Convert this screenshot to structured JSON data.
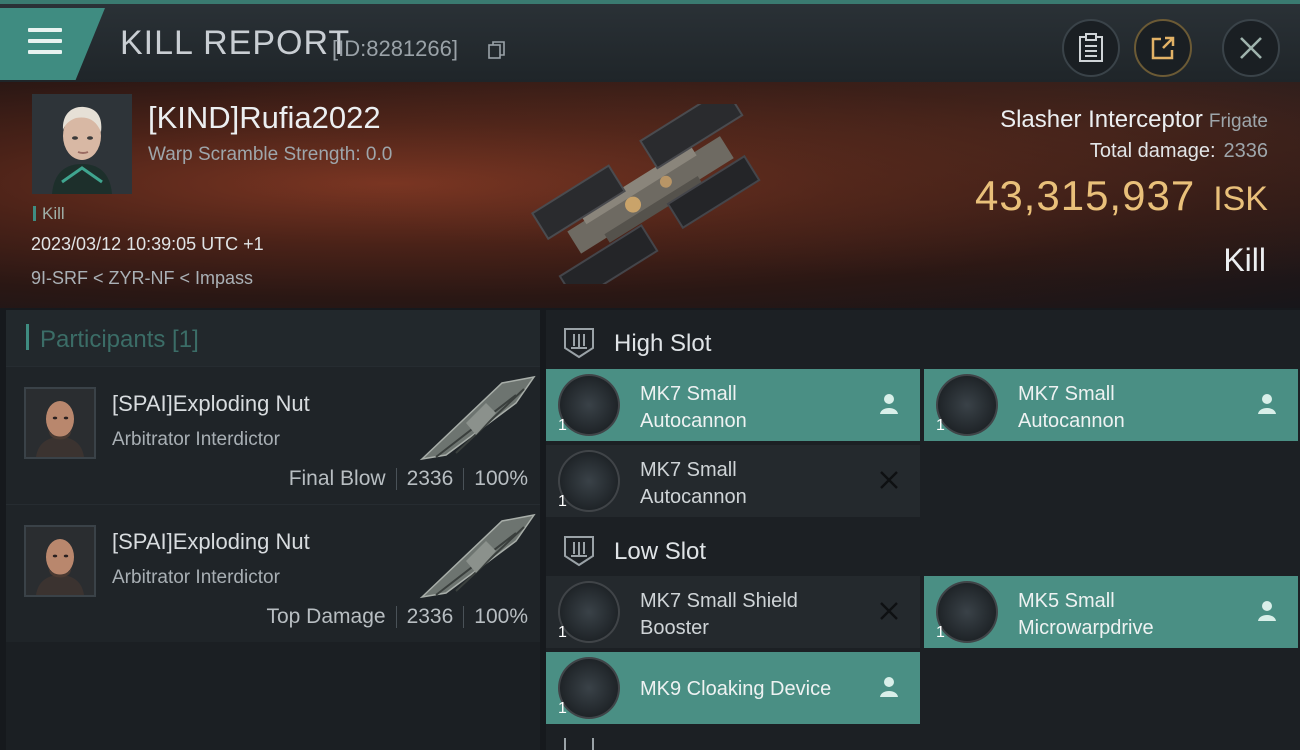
{
  "header": {
    "title": "KILL REPORT",
    "report_id": "[ID:8281266]"
  },
  "victim": {
    "name": "[KIND]Rufia2022",
    "scramble": "Warp Scramble Strength: 0.0",
    "tag": "Kill",
    "datetime": "2023/03/12 10:39:05 UTC +1",
    "location": "9I-SRF < ZYR-NF < Impass",
    "ship": "Slasher Interceptor",
    "ship_class": "Frigate",
    "total_damage_label": "Total damage:",
    "total_damage": "2336",
    "isk_value": "43,315,937",
    "isk_currency": "ISK",
    "result": "Kill"
  },
  "participants": {
    "label": "Participants [1]",
    "rows": [
      {
        "name": "[SPAI]Exploding Nut",
        "ship": "Arbitrator Interdictor",
        "role": "Final Blow",
        "damage": "2336",
        "percent": "100%"
      },
      {
        "name": "[SPAI]Exploding Nut",
        "ship": "Arbitrator Interdictor",
        "role": "Top Damage",
        "damage": "2336",
        "percent": "100%"
      }
    ]
  },
  "fitting": {
    "high_slot_label": "High Slot",
    "low_slot_label": "Low Slot",
    "high": [
      {
        "line1": "MK7 Small",
        "line2": "Autocannon",
        "qty": "1",
        "status": "dropped"
      },
      {
        "line1": "MK7 Small",
        "line2": "Autocannon",
        "qty": "1",
        "status": "dropped"
      },
      {
        "line1": "MK7 Small",
        "line2": "Autocannon",
        "qty": "1",
        "status": "destroyed"
      }
    ],
    "low": [
      {
        "line1": "MK7 Small Shield",
        "line2": "Booster",
        "qty": "1",
        "status": "destroyed"
      },
      {
        "line1": "MK5 Small",
        "line2": "Microwarpdrive",
        "qty": "1",
        "status": "dropped"
      },
      {
        "line1": "MK9 Cloaking Device",
        "line2": "",
        "qty": "1",
        "status": "dropped"
      }
    ]
  },
  "colors": {
    "accent": "#3f8c81",
    "isk_gold": "#e9c07a"
  }
}
